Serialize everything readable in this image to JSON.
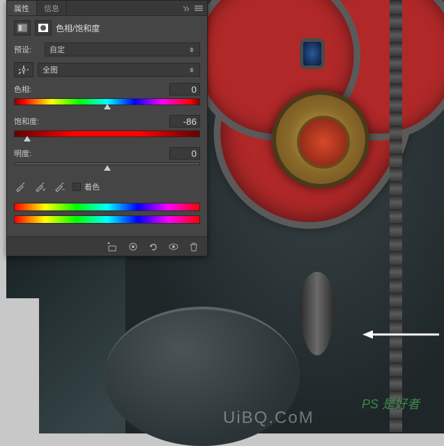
{
  "tabs": {
    "properties": "属性",
    "info": "信息"
  },
  "header": {
    "title": "色相/饱和度"
  },
  "preset": {
    "label": "预设:",
    "value": "自定"
  },
  "channel": {
    "value": "全图"
  },
  "sliders": {
    "hue": {
      "label": "色相:",
      "value": "0",
      "position": 50
    },
    "saturation": {
      "label": "饱和度:",
      "value": "-86",
      "position": 7
    },
    "lightness": {
      "label": "明度:",
      "value": "0",
      "position": 50
    }
  },
  "colorize": {
    "label": "着色",
    "checked": false
  },
  "watermark": {
    "main": "UiBQ.CoM",
    "ps": "PS 是好者"
  }
}
